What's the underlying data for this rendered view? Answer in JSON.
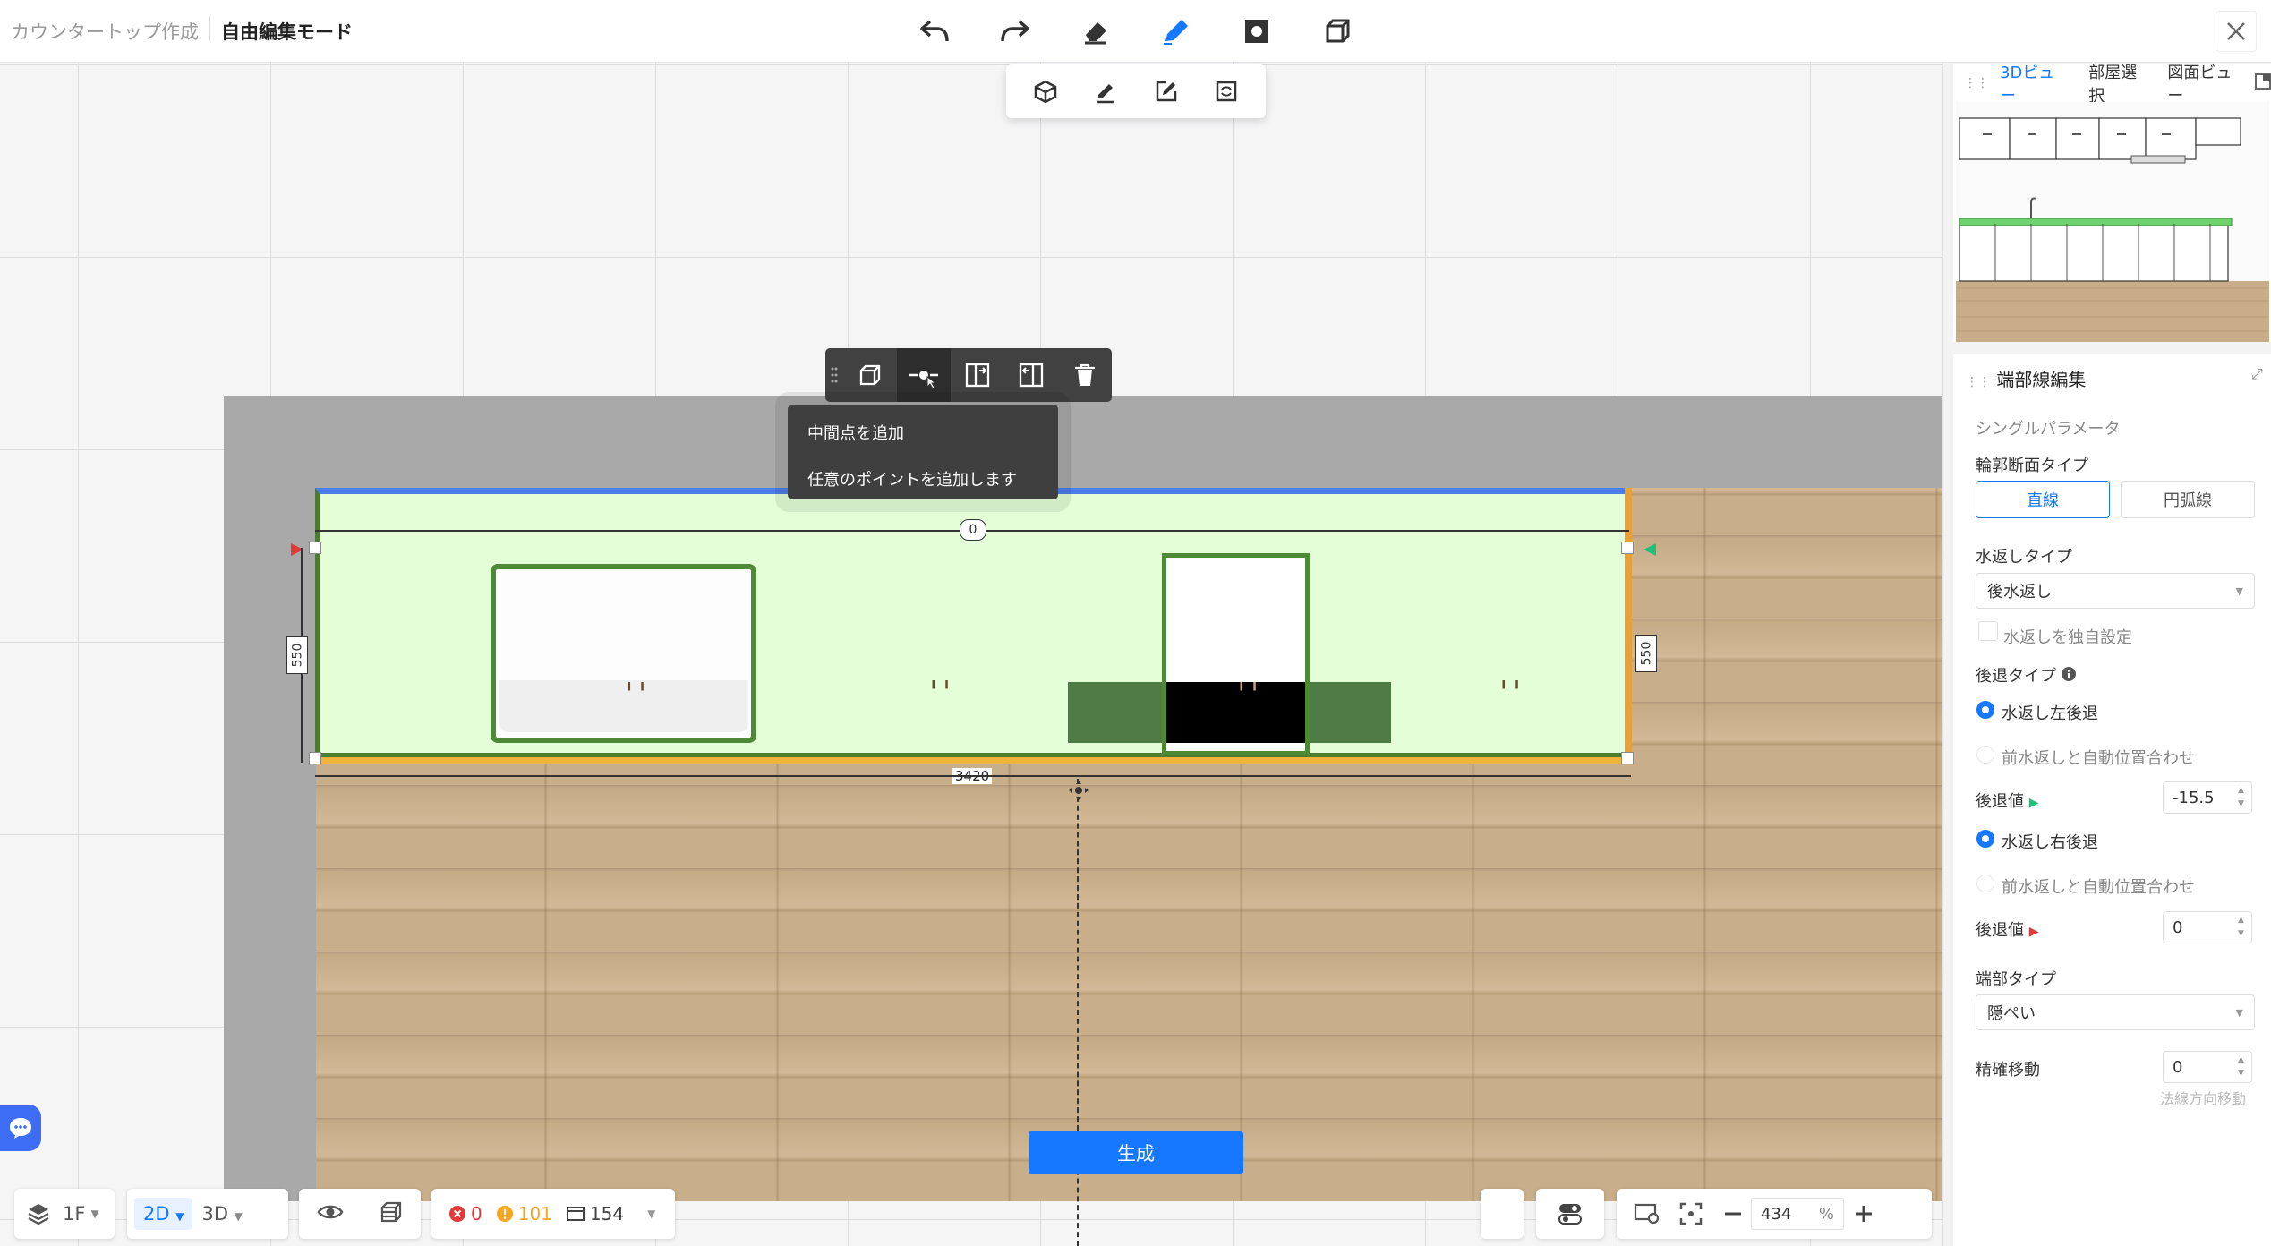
{
  "header": {
    "breadcrumb_parent": "カウンタートップ作成",
    "breadcrumb_current": "自由編集モード",
    "toolbar_icons": [
      "undo-icon",
      "redo-icon",
      "eraser-icon",
      "pencil-icon",
      "square-icon",
      "box-icon"
    ],
    "subtool_icons": [
      "cube-icon",
      "underline-pen-icon",
      "edit-square-icon",
      "refresh-square-icon"
    ]
  },
  "canvas": {
    "dim_top": "0",
    "dim_left": "550",
    "dim_right": "550",
    "dim_bottom": "3420",
    "context_toolbar": [
      "box-icon",
      "add-midpoint-icon",
      "split-left-icon",
      "split-right-icon",
      "trash-icon"
    ],
    "tooltip_title": "中間点を追加",
    "tooltip_desc": "任意のポイントを追加します",
    "generate_button": "生成"
  },
  "bottom_bar": {
    "floor": "1F",
    "view_2d": "2D",
    "view_3d": "3D",
    "errors": "0",
    "warnings": "101",
    "items": "154",
    "zoom": "434",
    "zoom_unit": "%"
  },
  "right_panel": {
    "tabs": [
      "3Dビュー",
      "部屋選択",
      "図面ビュー"
    ],
    "edit_title": "端部線編集",
    "single_param": "シングルパラメータ",
    "profile_type_label": "輪郭断面タイプ",
    "profile_straight": "直線",
    "profile_arc": "円弧線",
    "backsplash_type_label": "水返しタイプ",
    "backsplash_type_value": "後水返し",
    "backsplash_custom": "水返しを独自設定",
    "retreat_type_label": "後退タイプ",
    "left_retreat": "水返し左後退",
    "auto_align_1": "前水返しと自動位置合わせ",
    "retreat_value_label_1": "後退値",
    "retreat_value_1": "-15.5",
    "right_retreat": "水返し右後退",
    "auto_align_2": "前水返しと自動位置合わせ",
    "retreat_value_label_2": "後退値",
    "retreat_value_2": "0",
    "end_type_label": "端部タイプ",
    "end_type_value": "隠ぺい",
    "precise_move_label": "精確移動",
    "precise_move_value": "0",
    "precise_move_hint": "法線方向移動"
  },
  "colors": {
    "accent": "#1677ff",
    "counter_fill": "#e4ffd8",
    "counter_border": "#4a7d2f",
    "back_edge": "#4a7ee8",
    "front_edge": "#f1b43a"
  }
}
